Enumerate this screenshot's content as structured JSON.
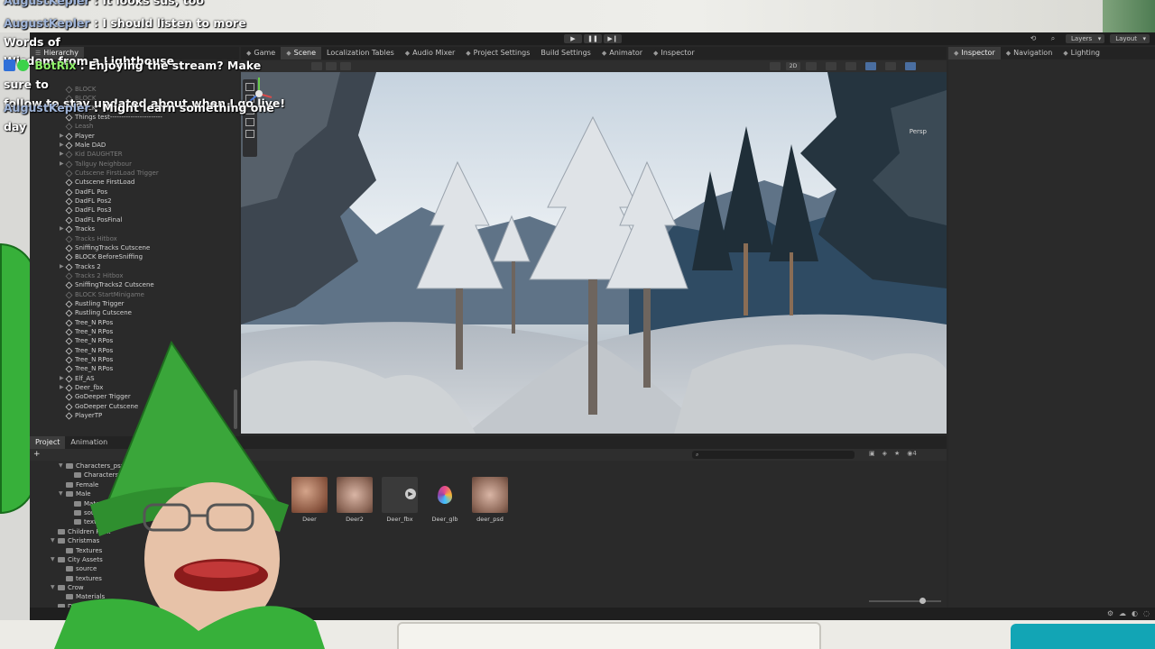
{
  "chat": {
    "messages": [
      {
        "user": "AugustKepler",
        "text": "It looks sus, too"
      },
      {
        "user": "AugustKepler",
        "text": "I should listen to more Words of",
        "text2": "Wisdom from a Lighthouse"
      },
      {
        "user": "BotRix",
        "text": "Enjoying the stream? Make sure to",
        "text2": "follow to stay updated about when I go live!"
      },
      {
        "user": "AugustKepler",
        "text": "Might learn something one day"
      }
    ],
    "separator": ":"
  },
  "toolbar": {
    "layers_label": "Layers",
    "layout_label": "Layout"
  },
  "hierarchy": {
    "tab_label": "Hierarchy",
    "items": [
      {
        "label": "BLOCK",
        "dim": true
      },
      {
        "label": "BLOCK",
        "dim": true
      },
      {
        "label": "BLOCK",
        "dim": false
      },
      {
        "label": "Things test-----------------------",
        "dim": false
      },
      {
        "label": "Leash",
        "dim": true
      },
      {
        "label": "Player",
        "dim": false,
        "arrow": true
      },
      {
        "label": "Male DAD",
        "dim": false,
        "arrow": true
      },
      {
        "label": "Kid DAUGHTER",
        "dim": true,
        "arrow": true
      },
      {
        "label": "Tallguy Neighbour",
        "dim": true,
        "arrow": true
      },
      {
        "label": "Cutscene FirstLoad Trigger",
        "dim": true
      },
      {
        "label": "Cutscene FirstLoad",
        "dim": false
      },
      {
        "label": "DadFL Pos",
        "dim": false
      },
      {
        "label": "DadFL Pos2",
        "dim": false
      },
      {
        "label": "DadFL Pos3",
        "dim": false
      },
      {
        "label": "DadFL PosFinal",
        "dim": false
      },
      {
        "label": "Tracks",
        "dim": false,
        "arrow": true
      },
      {
        "label": "Tracks Hitbox",
        "dim": true
      },
      {
        "label": "SniffingTracks Cutscene",
        "dim": false
      },
      {
        "label": "BLOCK BeforeSniffing",
        "dim": false
      },
      {
        "label": "Tracks 2",
        "dim": false,
        "arrow": true
      },
      {
        "label": "Tracks 2 Hitbox",
        "dim": true
      },
      {
        "label": "SniffingTracks2 Cutscene",
        "dim": false
      },
      {
        "label": "BLOCK StartMinigame",
        "dim": true
      },
      {
        "label": "Rustling Trigger",
        "dim": false
      },
      {
        "label": "Rustling Cutscene",
        "dim": false
      },
      {
        "label": "Tree_N RPos",
        "dim": false
      },
      {
        "label": "Tree_N RPos",
        "dim": false
      },
      {
        "label": "Tree_N RPos",
        "dim": false
      },
      {
        "label": "Tree_N RPos",
        "dim": false
      },
      {
        "label": "Tree_N RPos",
        "dim": false
      },
      {
        "label": "Tree_N RPos",
        "dim": false
      },
      {
        "label": "Elf_AS",
        "dim": false,
        "arrow": true
      },
      {
        "label": "Deer_fbx",
        "dim": false,
        "arrow": true
      },
      {
        "label": "GoDeeper Trigger",
        "dim": false
      },
      {
        "label": "GoDeeper Cutscene",
        "dim": false
      },
      {
        "label": "PlayerTP",
        "dim": false
      }
    ]
  },
  "scene_tabs": [
    {
      "label": "Game",
      "icon": "game-icon",
      "active": false
    },
    {
      "label": "Scene",
      "icon": "scene-icon",
      "active": true
    },
    {
      "label": "Localization Tables",
      "icon": "",
      "active": false
    },
    {
      "label": "Audio Mixer",
      "icon": "audio-icon",
      "active": false
    },
    {
      "label": "Project Settings",
      "icon": "gear-icon",
      "active": false
    },
    {
      "label": "Build Settings",
      "icon": "",
      "active": false
    },
    {
      "label": "Animator",
      "icon": "animator-icon",
      "active": false
    },
    {
      "label": "Inspector",
      "icon": "info-icon",
      "active": false
    }
  ],
  "right_tabs": [
    {
      "label": "Inspector",
      "icon": "info-icon",
      "active": true
    },
    {
      "label": "Navigation",
      "icon": "navigation-icon",
      "active": false
    },
    {
      "label": "Lighting",
      "icon": "lighting-icon",
      "active": false
    }
  ],
  "scene": {
    "gizmo_label": "Persp",
    "toolbar_2d": "2D"
  },
  "project": {
    "tabs": [
      {
        "label": "Project",
        "active": true
      },
      {
        "label": "Animation",
        "active": false
      }
    ],
    "plus_label": "+",
    "hidden_count": "4",
    "tree": [
      {
        "label": "Characters_psx",
        "indent": 2,
        "open": true
      },
      {
        "label": "Characters_psx",
        "indent": 3,
        "open": false
      },
      {
        "label": "Female",
        "indent": 2,
        "open": false
      },
      {
        "label": "Male",
        "indent": 2,
        "open": true
      },
      {
        "label": "Materials",
        "indent": 3,
        "open": false
      },
      {
        "label": "source",
        "indent": 3,
        "open": false
      },
      {
        "label": "textures",
        "indent": 3,
        "open": false
      },
      {
        "label": "Children Pack",
        "indent": 1,
        "open": false
      },
      {
        "label": "Christmas",
        "indent": 1,
        "open": true
      },
      {
        "label": "Textures",
        "indent": 2,
        "open": false
      },
      {
        "label": "City Assets",
        "indent": 1,
        "open": true
      },
      {
        "label": "source",
        "indent": 2,
        "open": false
      },
      {
        "label": "textures",
        "indent": 2,
        "open": false
      },
      {
        "label": "Crow",
        "indent": 1,
        "open": true
      },
      {
        "label": "Materials",
        "indent": 2,
        "open": false
      },
      {
        "label": "Deer",
        "indent": 1,
        "open": false
      }
    ],
    "assets": [
      {
        "name": "Deer",
        "kind": "deer"
      },
      {
        "name": "Deer2",
        "kind": "deer2"
      },
      {
        "name": "Deer_fbx",
        "kind": "fbx"
      },
      {
        "name": "Deer_glb",
        "kind": "glb"
      },
      {
        "name": "deer_psd",
        "kind": "deer2"
      }
    ]
  },
  "colors": {
    "editor_bg": "#282828",
    "chat_user": "#9fb4d8",
    "bot_user": "#8ef06a",
    "hat_green": "#3aa63a"
  }
}
